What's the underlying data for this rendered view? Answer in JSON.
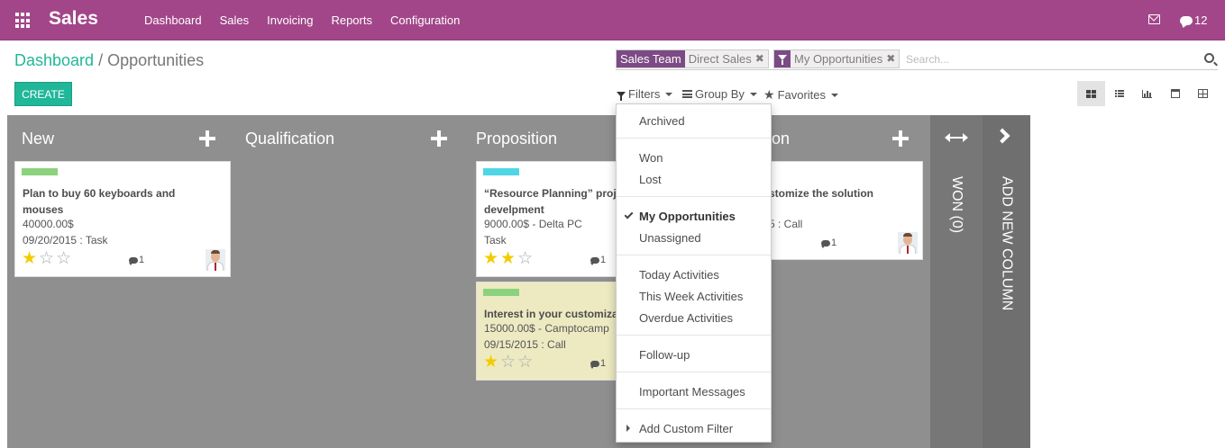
{
  "app": {
    "title": "Sales"
  },
  "nav": {
    "items": [
      "Dashboard",
      "Sales",
      "Invoicing",
      "Reports",
      "Configuration"
    ]
  },
  "systray": {
    "chat_count": "12"
  },
  "breadcrumb": {
    "parent": "Dashboard",
    "separator": "/",
    "current": "Opportunities"
  },
  "actions": {
    "create_label": "CREATE"
  },
  "search": {
    "facets": [
      {
        "title": "Sales Team",
        "value": "Direct Sales"
      },
      {
        "title": "filter-icon",
        "value": "My Opportunities"
      }
    ],
    "remove_glyph": "✖",
    "placeholder": "Search..."
  },
  "controls": {
    "filters": "Filters",
    "group_by": "Group By",
    "favorites": "Favorites"
  },
  "views": [
    "kanban",
    "list",
    "graph",
    "calendar",
    "pivot"
  ],
  "columns": [
    {
      "title": "New",
      "cards": [
        {
          "tag_color": "#8bd27d",
          "title_lines": [
            "Plan to buy 60 keyboards and",
            "mouses"
          ],
          "amount": "40000.00$",
          "detail": "09/20/2015 : Task",
          "stars": 1,
          "messages": "1"
        }
      ]
    },
    {
      "title": "Qualification",
      "cards": []
    },
    {
      "title": "Proposition",
      "cards": [
        {
          "tag_color": "#4fd6e6",
          "title_lines": [
            "“Resource Planning” proje",
            "develpment"
          ],
          "amount": "9000.00$ - Delta PC",
          "detail": "Task",
          "stars": 2,
          "messages": "1"
        },
        {
          "tag_color": "#8bd27d",
          "title_lines": [
            "Interest in your customiza"
          ],
          "amount": "15000.00$ - Camptocamp",
          "detail": "09/15/2015 : Call",
          "stars": 1,
          "messages": "1"
        }
      ]
    },
    {
      "title": "on",
      "cards": [
        {
          "title_lines": [
            "stomize the solution"
          ],
          "detail": "5 : Call",
          "messages": "1"
        }
      ]
    }
  ],
  "folded": {
    "won": "WON (0)",
    "add_column": "ADD NEW COLUMN"
  },
  "filters_menu": {
    "items": [
      "Archived",
      "Won",
      "Lost",
      "My Opportunities",
      "Unassigned",
      "Today Activities",
      "This Week Activities",
      "Overdue Activities",
      "Follow-up",
      "Important Messages",
      "Add Custom Filter"
    ],
    "checked": "My Opportunities"
  },
  "colors": {
    "brand": "#a24689",
    "accent": "#21b799",
    "column": "#8f8f8f",
    "star": "#f3cc00"
  }
}
